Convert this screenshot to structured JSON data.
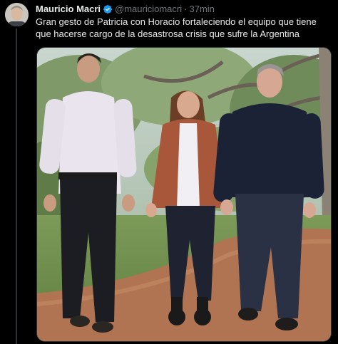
{
  "tweet": {
    "author_name": "Mauricio Macri",
    "handle": "@mauriciomacri",
    "separator": "·",
    "time": "37min",
    "text": "Gran gesto de Patricia con Horacio fortaleciendo el equipo que tiene que hacerse cargo de la desastrosa crisis que sufre la Argentina"
  },
  "icons": {
    "verified": "verified-badge-icon"
  },
  "colors": {
    "background": "#000000",
    "text_primary": "#e7e9ea",
    "text_secondary": "#71767b",
    "verified_blue": "#1d9bf0",
    "border": "#2f3336"
  }
}
